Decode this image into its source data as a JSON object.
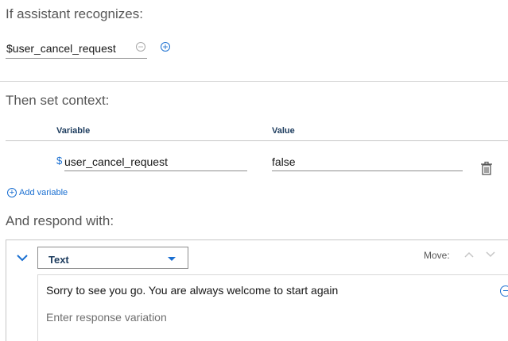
{
  "condition": {
    "heading": "If assistant recognizes:",
    "value": "$user_cancel_request",
    "remove_label": "−",
    "add_label": "+"
  },
  "context": {
    "heading": "Then set context:",
    "columns": {
      "variable": "Variable",
      "value": "Value"
    },
    "rows": [
      {
        "prefix": "$",
        "variable": "user_cancel_request",
        "value": "false",
        "delete_icon": "trash-icon"
      }
    ],
    "add_variable_label": "Add variable"
  },
  "response": {
    "heading": "And respond with:",
    "type_select": "Text",
    "move_label": "Move:",
    "variations": [
      "Sorry to see you go. You are always welcome to start again"
    ],
    "variation_placeholder": "Enter response variation"
  },
  "colors": {
    "accent": "#1a6fd1",
    "heading_text": "#565656",
    "column_header": "#1d3c5e"
  }
}
